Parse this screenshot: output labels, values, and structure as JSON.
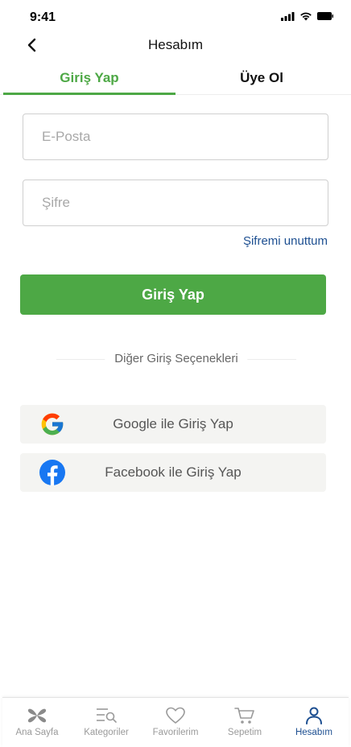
{
  "status_bar": {
    "time": "9:41"
  },
  "header": {
    "title": "Hesabım",
    "back_icon": "chevron-left-icon"
  },
  "tabs": [
    {
      "label": "Giriş Yap",
      "active": true
    },
    {
      "label": "Üye Ol",
      "active": false
    }
  ],
  "form": {
    "email": {
      "placeholder": "E-Posta",
      "value": ""
    },
    "password": {
      "placeholder": "Şifre",
      "value": ""
    },
    "forgot_password": "Şifremi unuttum",
    "submit_label": "Giriş Yap"
  },
  "divider": {
    "label": "Diğer Giriş Seçenekleri"
  },
  "social": {
    "google": {
      "label": "Google ile Giriş Yap",
      "icon": "google-icon"
    },
    "facebook": {
      "label": "Facebook ile Giriş Yap",
      "icon": "facebook-icon"
    }
  },
  "bottom_nav": [
    {
      "label": "Ana Sayfa",
      "icon": "home-logo-icon",
      "active": false
    },
    {
      "label": "Kategoriler",
      "icon": "categories-icon",
      "active": false
    },
    {
      "label": "Favorilerim",
      "icon": "heart-icon",
      "active": false
    },
    {
      "label": "Sepetim",
      "icon": "cart-icon",
      "active": false
    },
    {
      "label": "Hesabım",
      "icon": "user-icon",
      "active": true
    }
  ],
  "colors": {
    "primary_green": "#4da845",
    "link_blue": "#1d4f91",
    "inactive_gray": "#9a9a9a",
    "social_bg": "#f4f4f2"
  }
}
